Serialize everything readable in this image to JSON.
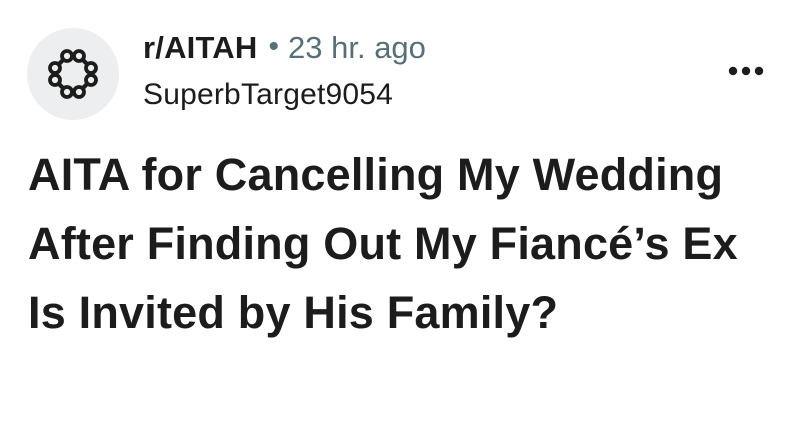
{
  "post": {
    "subreddit": "r/AITAH",
    "separator": "•",
    "time_ago": "23 hr. ago",
    "username": "SuperbTarget9054",
    "title": "AITA for Cancelling My Wedding After Finding Out My Fiancé’s Ex Is Invited by His Family?",
    "avatar_icon": "subreddit-avatar-icon",
    "more_icon": "overflow-menu-icon"
  },
  "colors": {
    "text_primary": "#1c1c1c",
    "text_secondary": "#576f76",
    "avatar_background": "#eceeef"
  }
}
